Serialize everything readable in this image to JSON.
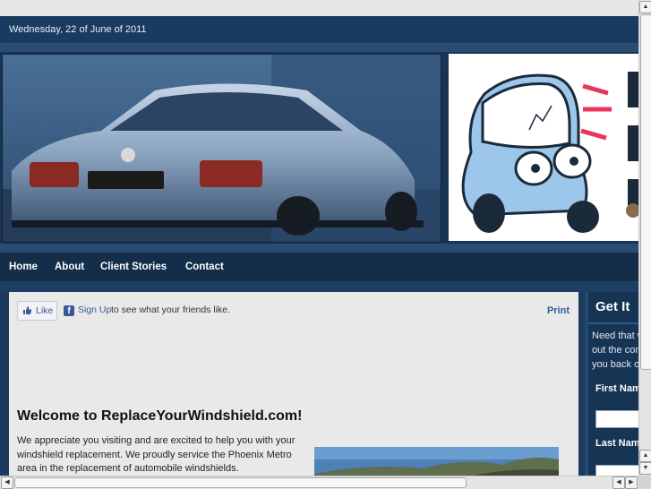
{
  "header": {
    "date": "Wednesday, 22 of June of 2011"
  },
  "nav": {
    "items": [
      {
        "label": "Home"
      },
      {
        "label": "About"
      },
      {
        "label": "Client Stories"
      },
      {
        "label": "Contact"
      }
    ]
  },
  "social": {
    "like_label": "Like",
    "signup_link": "Sign Up",
    "signup_text": "to see what your friends like."
  },
  "main": {
    "print_label": "Print",
    "heading": "Welcome to ReplaceYourWindshield.com!",
    "paragraph": "We appreciate you visiting and are excited to help you with your windshield replacement. We proudly service the Phoenix Metro area in the replacement of automobile windshields."
  },
  "sidebar": {
    "title": "Get It",
    "text_lines": [
      "Need that w",
      "out the con",
      "you back o"
    ],
    "first_name_label": "First Nam",
    "last_name_label": "Last Nam"
  },
  "colors": {
    "page_bg": "#1c3a5c",
    "nav_bg": "#142d49",
    "content_bg": "#e9e9e9",
    "facebook_blue": "#3b5998",
    "link_blue": "#2e5f96"
  },
  "icons": {
    "like": "thumbs-up-icon",
    "facebook": "facebook-icon",
    "scroll_up": "arrow-up-icon",
    "scroll_down": "arrow-down-icon",
    "scroll_left": "arrow-left-icon",
    "scroll_right": "arrow-right-icon"
  }
}
